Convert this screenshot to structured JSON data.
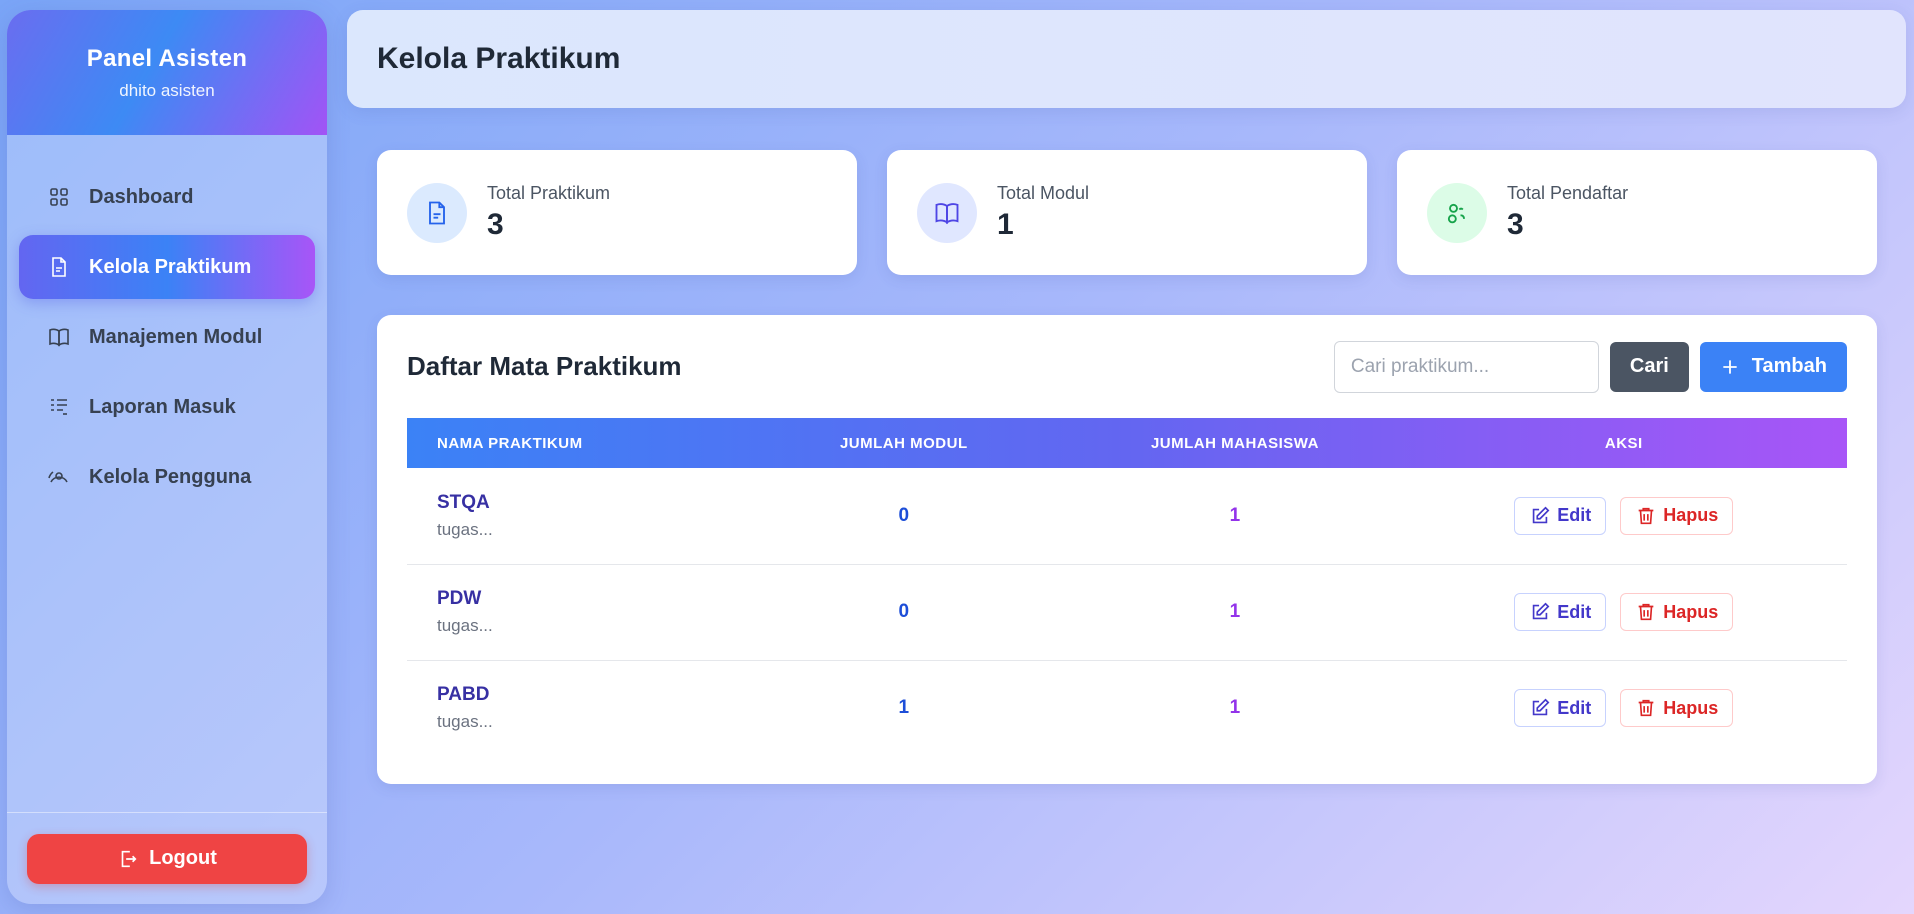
{
  "sidebar": {
    "title": "Panel Asisten",
    "user": "dhito asisten",
    "items": [
      {
        "label": "Dashboard",
        "icon": "grid-icon"
      },
      {
        "label": "Kelola Praktikum",
        "icon": "file-icon"
      },
      {
        "label": "Manajemen Modul",
        "icon": "book-icon"
      },
      {
        "label": "Laporan Masuk",
        "icon": "report-icon"
      },
      {
        "label": "Kelola Pengguna",
        "icon": "users-icon"
      }
    ],
    "active_index": 1,
    "logout_label": "Logout"
  },
  "header": {
    "title": "Kelola Praktikum"
  },
  "stats": [
    {
      "label": "Total Praktikum",
      "value": "3",
      "icon": "file-icon",
      "color": "#2563eb"
    },
    {
      "label": "Total Modul",
      "value": "1",
      "icon": "book-icon",
      "color": "#4f46e5"
    },
    {
      "label": "Total Pendaftar",
      "value": "3",
      "icon": "users-icon",
      "color": "#16a34a"
    }
  ],
  "list": {
    "title": "Daftar Mata Praktikum",
    "search_placeholder": "Cari praktikum...",
    "search_button": "Cari",
    "add_button": "Tambah",
    "columns": [
      "NAMA PRAKTIKUM",
      "JUMLAH MODUL",
      "JUMLAH MAHASISWA",
      "AKSI"
    ],
    "rows": [
      {
        "name": "STQA",
        "desc": "tugas...",
        "modul": "0",
        "mahasiswa": "1"
      },
      {
        "name": "PDW",
        "desc": "tugas...",
        "modul": "0",
        "mahasiswa": "1"
      },
      {
        "name": "PABD",
        "desc": "tugas...",
        "modul": "1",
        "mahasiswa": "1"
      }
    ],
    "edit_label": "Edit",
    "delete_label": "Hapus"
  }
}
